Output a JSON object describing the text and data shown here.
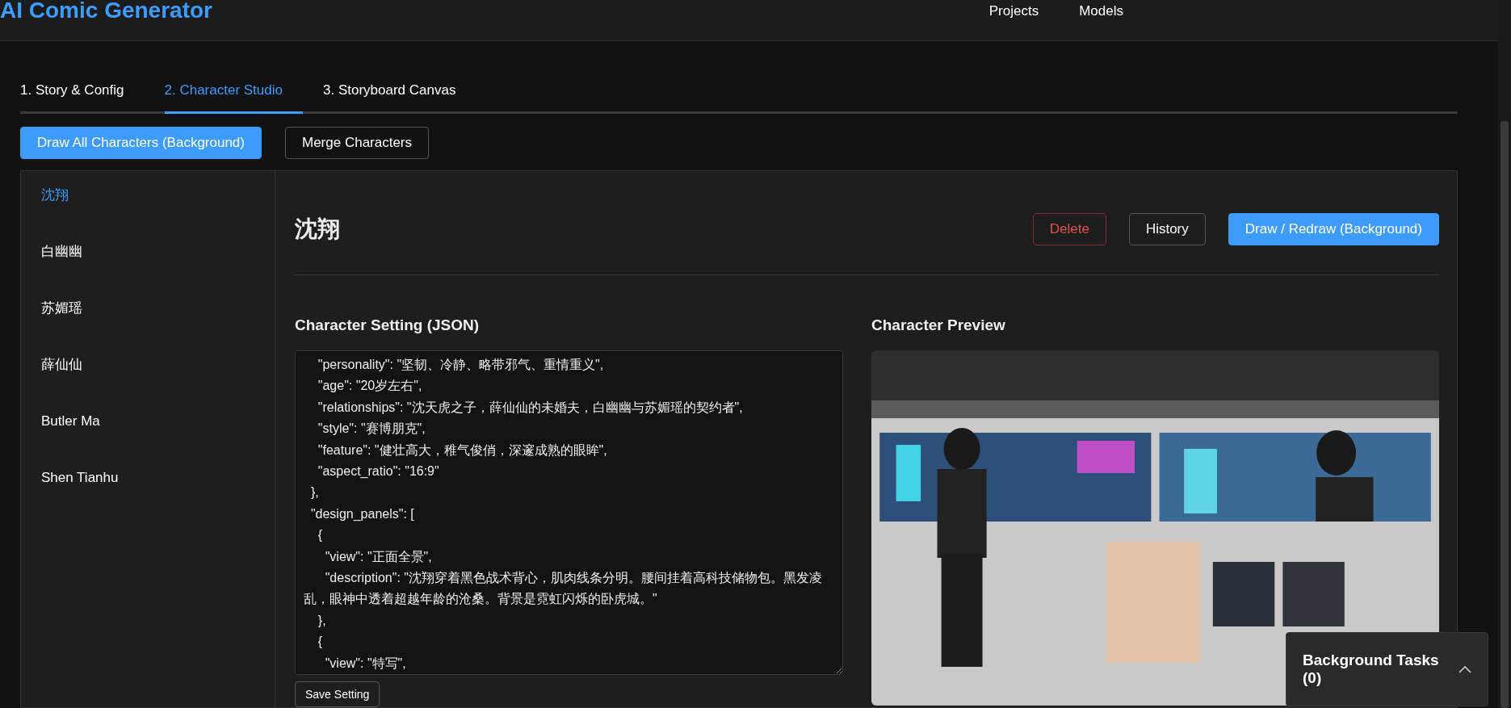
{
  "header": {
    "title": "AI Comic Generator",
    "nav": [
      "Projects",
      "Models"
    ]
  },
  "tabs": [
    {
      "label": "1. Story & Config",
      "selected": false
    },
    {
      "label": "2. Character Studio",
      "selected": true
    },
    {
      "label": "3. Storyboard Canvas",
      "selected": false
    }
  ],
  "actions": [
    {
      "label": "Draw All Characters (Background)",
      "kind": "primary"
    },
    {
      "label": "Merge Characters",
      "kind": "outline"
    }
  ],
  "sidebar": {
    "items": [
      {
        "label": "沈翔",
        "selected": true
      },
      {
        "label": "白幽幽",
        "selected": false
      },
      {
        "label": "苏媚瑶",
        "selected": false
      },
      {
        "label": "薛仙仙",
        "selected": false
      },
      {
        "label": "Butler Ma",
        "selected": false
      },
      {
        "label": "Shen Tianhu",
        "selected": false
      }
    ]
  },
  "character": {
    "name": "沈翔",
    "buttons": [
      {
        "label": "Delete",
        "kind": "danger"
      },
      {
        "label": "History",
        "kind": "outline"
      },
      {
        "label": "Draw / Redraw (Background)",
        "kind": "primary"
      }
    ]
  },
  "setting": {
    "heading": "Character Setting (JSON)",
    "lines": [
      "    \"personality\": \"坚韧、冷静、略带邪气、重情重义\",",
      "    \"age\": \"20岁左右\",",
      "    \"relationships\": \"沈天虎之子，薛仙仙的未婚夫，白幽幽与苏媚瑶的契约者\",",
      "    \"style\": \"赛博朋克\",",
      "    \"feature\": \"健壮高大，稚气俊俏，深邃成熟的眼眸\",",
      "    \"aspect_ratio\": \"16:9\"",
      "  },",
      "  \"design_panels\": [",
      "    {",
      "      \"view\": \"正面全景\",",
      "      \"description\": \"沈翔穿着黑色战术背心，肌肉线条分明。腰间挂着高科技储物包。黑发凌乱，眼神中透着超越年龄的沧桑。背景是霓虹闪烁的卧虎城。\"",
      "    },",
      "    {",
      "      \"view\": \"特写\","
    ],
    "save_button": "Save Setting"
  },
  "preview": {
    "heading": "Character Preview"
  },
  "background_tasks": {
    "label": "Background Tasks (0)",
    "expanded": false
  }
}
